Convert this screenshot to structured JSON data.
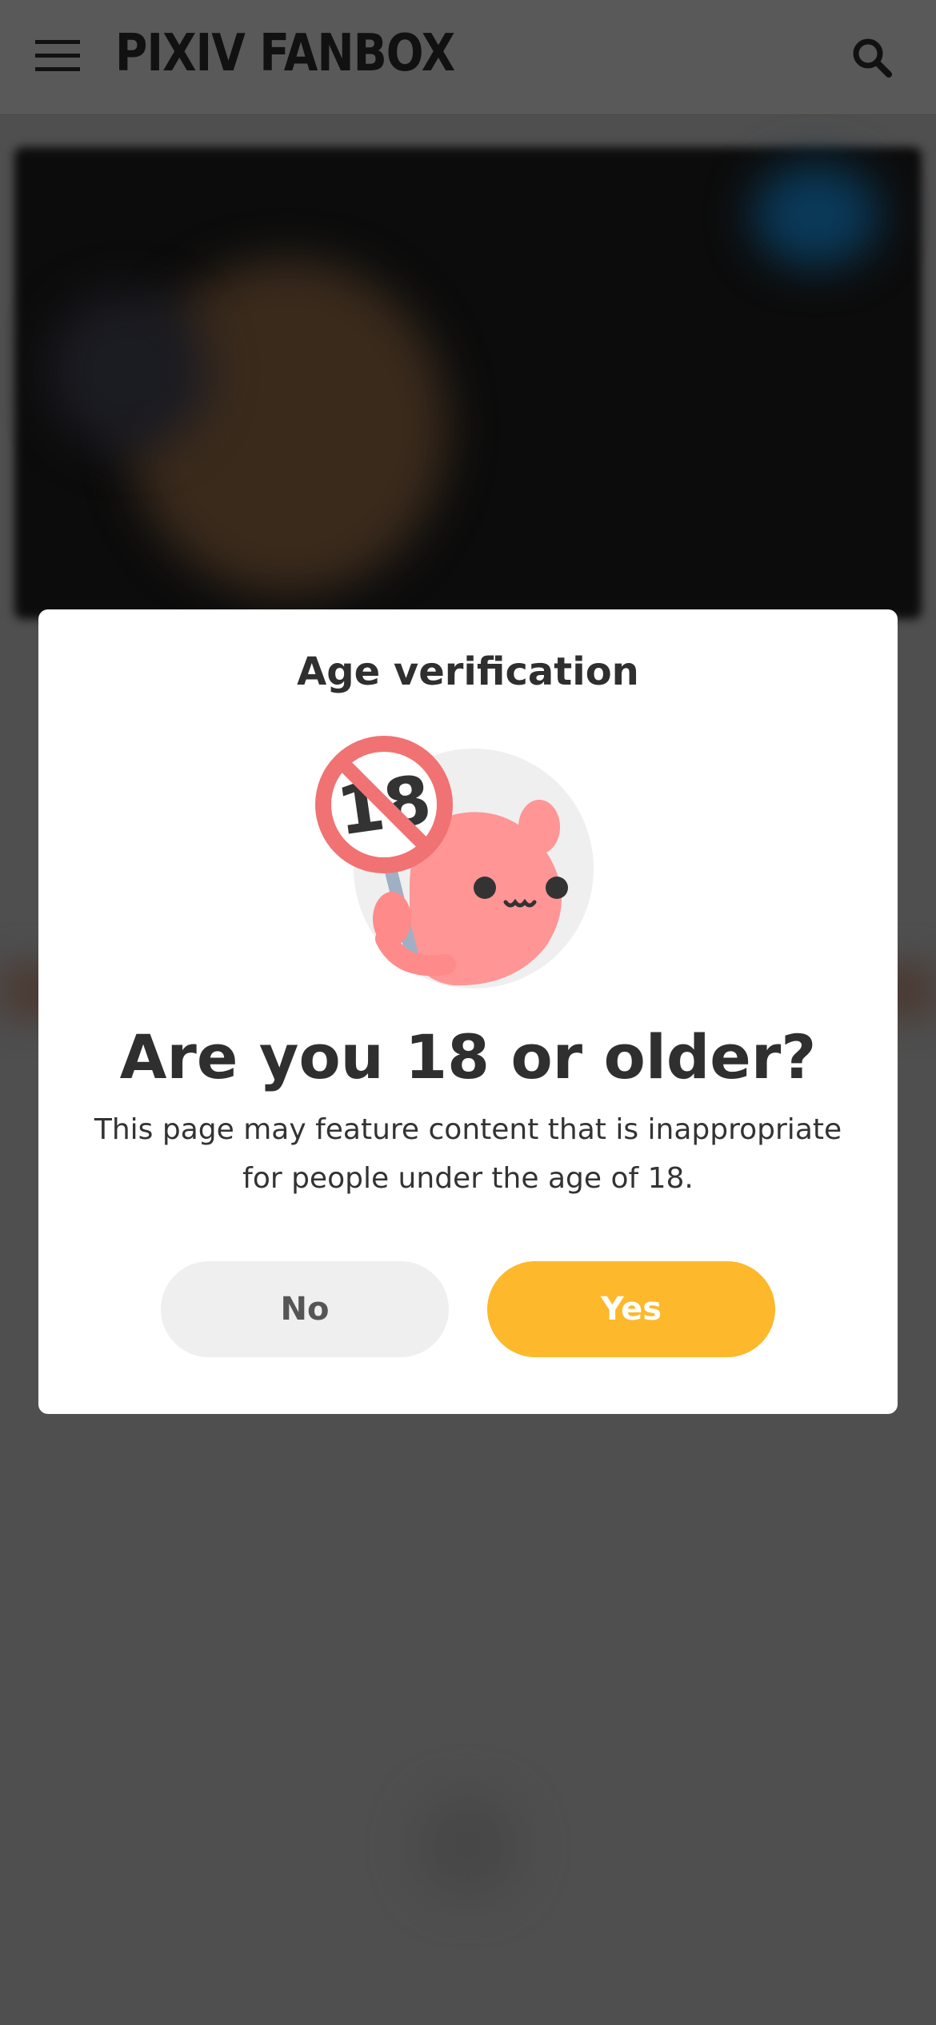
{
  "header": {
    "logo_text": "PIXIV FANBOX",
    "menu_icon": "hamburger-menu-icon",
    "search_icon": "search-icon"
  },
  "age_modal": {
    "title": "Age verification",
    "illustration": "age-restricted-mascot-icon",
    "question": "Are you 18 or older?",
    "description": "This page may feature content that is inappropriate for people under the age of 18.",
    "no_label": "No",
    "yes_label": "Yes"
  },
  "colors": {
    "overlay_bg": "#4f4f4f",
    "header_bg": "#595959",
    "yes_button": "#fdb82b",
    "no_button": "#efefef"
  }
}
